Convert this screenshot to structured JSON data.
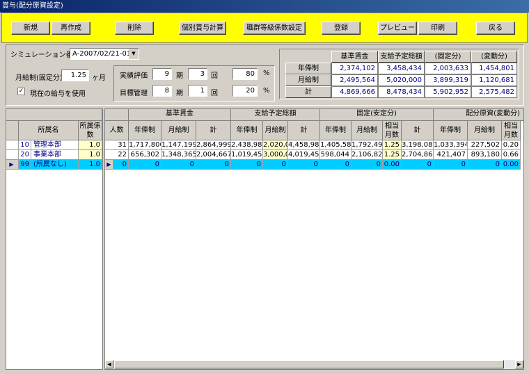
{
  "window": {
    "title": "賞与(配分原資設定)"
  },
  "toolbar": {
    "new": "新規",
    "recreate": "再作成",
    "delete": "削除",
    "individual_calc": "個別賞与計算",
    "grade_coef": "職群等級係数設定",
    "register": "登録",
    "preview": "プレビュー",
    "print": "印刷",
    "back": "戻る"
  },
  "settings": {
    "sim_label": "シミュレーション番号",
    "sim_value": "A-2007/02/21-01",
    "monthly_label": "月給制(固定分)",
    "monthly_value": "1.25",
    "month_unit": "ヶ月",
    "use_current_label": "現在の給与を使用",
    "use_current_checked": true,
    "perf_label": "実績評価",
    "perf_period": "9",
    "perf_period_unit": "期",
    "perf_round": "3",
    "perf_round_unit": "回",
    "perf_pct": "80",
    "pct_unit": "%",
    "goal_label": "目標管理",
    "goal_period": "8",
    "goal_period_unit": "期",
    "goal_round": "1",
    "goal_round_unit": "回",
    "goal_pct": "20"
  },
  "summary": {
    "headers": [
      "基準賃金",
      "支給予定総額",
      "(固定分)",
      "(変動分)"
    ],
    "rows": [
      {
        "label": "年俸制",
        "values": [
          "2,374,102",
          "3,458,434",
          "2,003,633",
          "1,454,801"
        ]
      },
      {
        "label": "月給制",
        "values": [
          "2,495,564",
          "5,020,000",
          "3,899,319",
          "1,120,681"
        ]
      },
      {
        "label": "計",
        "values": [
          "4,869,666",
          "8,478,434",
          "5,902,952",
          "2,575,482"
        ]
      }
    ]
  },
  "left_grid": {
    "header_name": "所属名",
    "header_coef": "所属係数",
    "rows": [
      {
        "code": "10",
        "name": "管理本部",
        "coef": "1.0"
      },
      {
        "code": "20",
        "name": "事業本部",
        "coef": "1.0"
      },
      {
        "code": "99",
        "name": "(所属なし)",
        "coef": "1.0"
      }
    ]
  },
  "right_grid": {
    "group_headers": [
      "基準賃金",
      "支給予定総額",
      "固定(安定分)",
      "配分原資(変動分)"
    ],
    "col_headers": [
      "人数",
      "年俸制",
      "月給制",
      "計",
      "年俸制",
      "月給制",
      "計",
      "年俸制",
      "月給制",
      "相当月数",
      "計",
      "年俸制",
      "月給制",
      "相当月数"
    ],
    "rows": [
      [
        "31",
        "1,717,800",
        "1,147,199",
        "2,864,999",
        "2,438,983",
        "2,020,00",
        "4,458,983",
        "1,405,589",
        "1,792,498",
        "1.25",
        "3,198,087",
        "1,033,394",
        "227,502",
        "0.20"
      ],
      [
        "22",
        "656,302",
        "1,348,365",
        "2,004,667",
        "1,019,451",
        "3,000,00",
        "4,019,451",
        "598,044",
        "2,106,820",
        "1.25",
        "2,704,864",
        "421,407",
        "893,180",
        "0.66"
      ],
      [
        "0",
        "0",
        "0",
        "0",
        "0",
        "0",
        "0",
        "0",
        "0",
        "0.00",
        "0",
        "0",
        "0",
        "0.00"
      ]
    ]
  }
}
